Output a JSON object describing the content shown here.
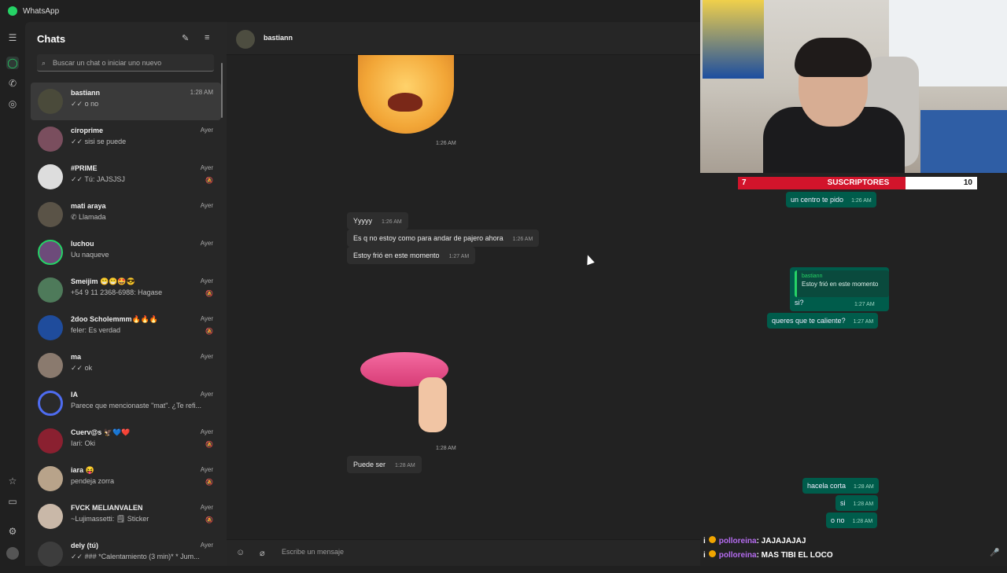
{
  "app": {
    "title": "WhatsApp"
  },
  "sidebar": {
    "title": "Chats",
    "search_placeholder": "Buscar un chat o iniciar uno nuevo",
    "chats": [
      {
        "name": "bastiann",
        "time": "1:28 AM",
        "preview": "✓✓ o no"
      },
      {
        "name": "ciroprime",
        "time": "Ayer",
        "preview": "✓✓ sisi se puede"
      },
      {
        "name": "#PRIME",
        "time": "Ayer",
        "preview": "✓✓ Tú: JAJSJSJ"
      },
      {
        "name": "mati araya",
        "time": "Ayer",
        "preview": "✆ Llamada"
      },
      {
        "name": "luchou",
        "time": "Ayer",
        "preview": "Uu naqueve"
      },
      {
        "name": "Smeijim 😁😁🤩😎",
        "time": "Ayer",
        "preview": "+54 9 11 2368-6988: Hagase"
      },
      {
        "name": "2doo Scholemmm🔥🔥🔥",
        "time": "Ayer",
        "preview": "feler: Es verdad"
      },
      {
        "name": "ma",
        "time": "Ayer",
        "preview": "✓✓ ok"
      },
      {
        "name": "IA",
        "time": "Ayer",
        "preview": "Parece que mencionaste \"mat\". ¿Te refi..."
      },
      {
        "name": "Cuerv@s 🦅💙❤️",
        "time": "Ayer",
        "preview": "Iari: Oki"
      },
      {
        "name": "iara 😝",
        "time": "Ayer",
        "preview": "pendeja zorra"
      },
      {
        "name": "FVCK MELIANVALEN",
        "time": "Ayer",
        "preview": "~Lujimassetti: 🗒 Sticker"
      },
      {
        "name": "dely (tú)",
        "time": "Ayer",
        "preview": "✓✓ ### *Calentamiento (3 min)* * Jum..."
      }
    ]
  },
  "chat": {
    "contact": "bastiann",
    "sticker1_time": "1:26 AM",
    "incoming": [
      {
        "text": "Yyyyy",
        "time": "1:26 AM"
      },
      {
        "text": "Es q no estoy como para andar de pajero ahora",
        "time": "1:26 AM"
      },
      {
        "text": "Estoy frió en este momento",
        "time": "1:27 AM"
      }
    ],
    "sticker2_time": "1:28 AM",
    "incoming2": {
      "text": "Puede ser",
      "time": "1:28 AM"
    },
    "composer_placeholder": "Escribe un mensaje"
  },
  "overlay": {
    "subs_current": "7",
    "subs_label": "SUSCRIPTORES",
    "subs_goal": "10",
    "subs_progress": 0.7,
    "outgoing": [
      {
        "text": "un centro te pido",
        "time": "1:26 AM"
      },
      {
        "text": "si?",
        "time": "1:27 AM"
      },
      {
        "text": "queres que te caliente?",
        "time": "1:27 AM"
      },
      {
        "text": "hacela corta",
        "time": "1:28 AM"
      },
      {
        "text": "si",
        "time": "1:28 AM"
      },
      {
        "text": "o no",
        "time": "1:28 AM"
      }
    ],
    "quote": {
      "author": "bastiann",
      "text": "Estoy frió en este momento"
    },
    "stream_chat": [
      {
        "user": "polloreina",
        "message": ": JAJAJAJAJ"
      },
      {
        "user": "polloreina",
        "message": ": MAS TIBI EL LOCO"
      }
    ]
  },
  "colors": {
    "accent": "#25d366",
    "outgoing_bubble": "#005c4b",
    "subbar_fill": "#d2142b"
  }
}
